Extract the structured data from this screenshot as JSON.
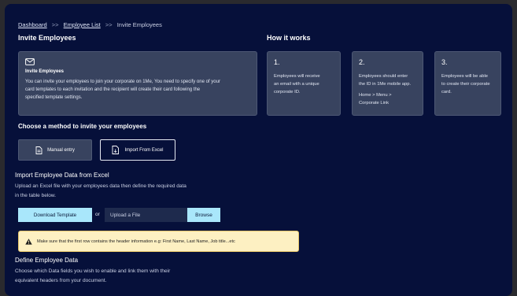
{
  "breadcrumb": {
    "items": [
      {
        "label": "Dashboard",
        "link": true
      },
      {
        "label": "Employee List",
        "link": true
      },
      {
        "label": "Invite Employees",
        "link": false
      }
    ],
    "separator": ">>"
  },
  "invite_section": {
    "heading": "Invite Employees",
    "card_title": "Invite Employees",
    "card_body_lines": [
      "You can invite your employees to join  your corporate on 1Me, You need to specify one of your",
      "card templates to each invitation and the recipient will create their card following the",
      "specified template settings."
    ]
  },
  "how_it_works": {
    "heading": "How it works",
    "steps": [
      {
        "num": "1.",
        "lines": [
          "Employees will receive",
          "an email with a unique",
          "corporate ID."
        ],
        "extra": []
      },
      {
        "num": "2.",
        "lines": [
          "Employees should enter",
          "the ID in 1Me mobile app."
        ],
        "extra": [
          "Home > Menu >",
          "Corporate Link"
        ]
      },
      {
        "num": "3.",
        "lines": [
          "Employees will be able",
          "to create their corporate",
          "card."
        ],
        "extra": []
      }
    ]
  },
  "method": {
    "heading": "Choose a method to invite your employees",
    "manual_label": "Manual entry",
    "excel_label": "Import From Excel"
  },
  "import_section": {
    "heading": "Import Employee Data from Excel",
    "desc_lines": [
      "Upload an Excel file with your employees data then define the required data",
      "in the table below."
    ],
    "download_label": "Download Template",
    "or_label": "or",
    "upload_placeholder": "Upload a File",
    "browse_label": "Browse",
    "warning_text": "Make sure that the first row contains the header information e.g: First Name, Last Name, Job title...etc"
  },
  "define_section": {
    "heading": "Define Employee Data",
    "desc_lines": [
      "Choose which Data fields you wish to enable and link them with their",
      "equivalent headers from your document."
    ]
  },
  "colors": {
    "background": "#06103a",
    "card": "#38435f",
    "accent": "#a9e7fb",
    "warning": "#fdf0c2"
  },
  "icons": [
    "mail-icon",
    "document-icon",
    "file-import-icon",
    "warning-icon"
  ]
}
